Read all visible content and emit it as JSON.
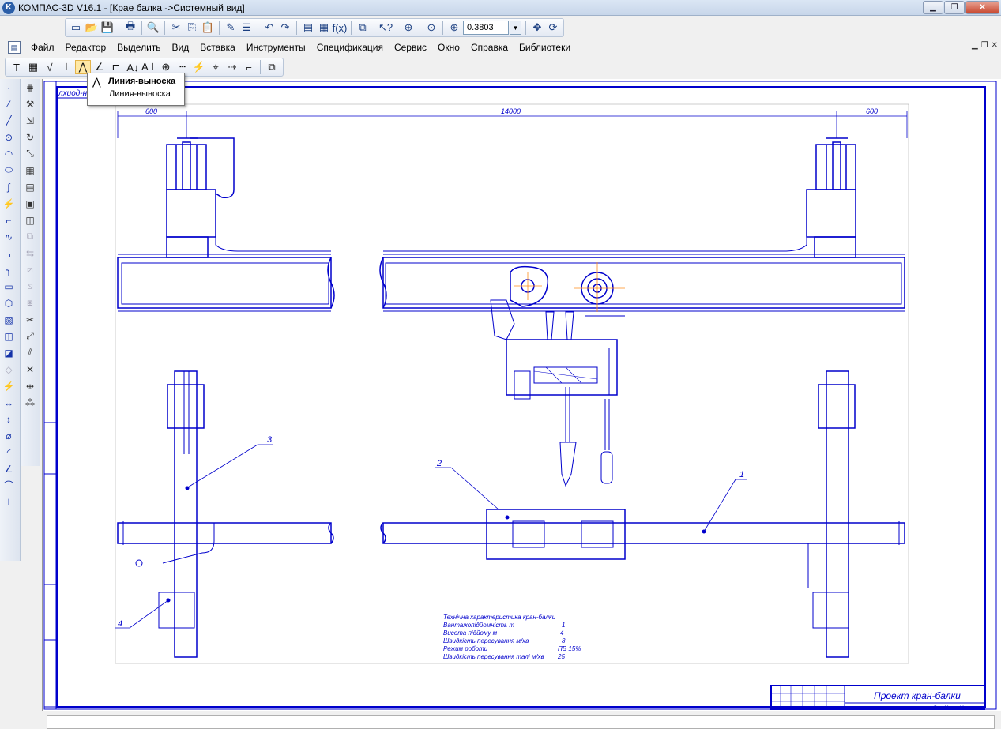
{
  "window": {
    "title": "КОМПАС-3D V16.1 - [Крае балка ->Системный вид]",
    "logo": "K"
  },
  "toolbar": {
    "zoom_value": "0.3803",
    "fx_label": "f(x)"
  },
  "menu": {
    "items": [
      "Файл",
      "Редактор",
      "Выделить",
      "Вид",
      "Вставка",
      "Инструменты",
      "Спецификация",
      "Сервис",
      "Окно",
      "Справка",
      "Библиотеки"
    ]
  },
  "tooltip": {
    "title": "Линия-выноска",
    "description": "Линия-выноска"
  },
  "drawing": {
    "tab_label": "лхиод-н",
    "dim_left": "600",
    "dim_center": "14000",
    "dim_right": "600",
    "leader_1": "1",
    "leader_2": "2",
    "leader_3": "3",
    "leader_4": "4",
    "spec_title": "Технічна характеристика кран-балки",
    "spec_rows": [
      {
        "label": "Вантажопідйомність  т",
        "value": "1"
      },
      {
        "label": "Висота підйому  м",
        "value": "4"
      },
      {
        "label": "Швидкість пересування м/хв",
        "value": "8"
      },
      {
        "label": "Режим роботи",
        "value": "ПВ 15%"
      },
      {
        "label": "Швидкість пересування талі м/хв",
        "value": "25"
      }
    ],
    "stamp_title": "Проект кран-балки",
    "stamp_small": "Лит  Масса  Масшт"
  },
  "colors": {
    "drawing_line": "#0000cc",
    "axis_line": "#ff8c1a"
  }
}
